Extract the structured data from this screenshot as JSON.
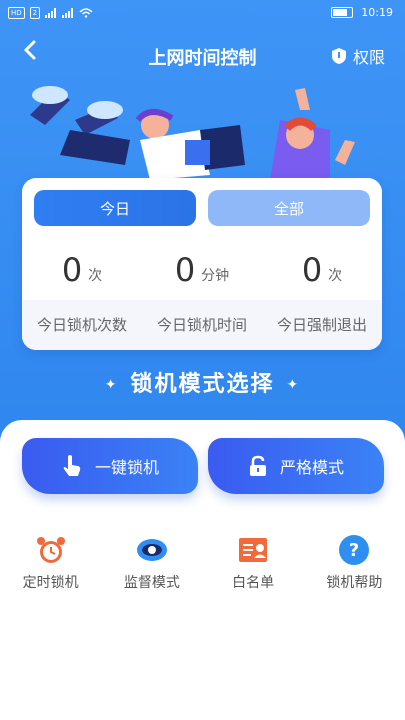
{
  "status": {
    "left_icons": [
      "hd-icon",
      "sim-icon",
      "signal-icon",
      "signal-4g-icon",
      "wifi-icon"
    ],
    "time": "10:19"
  },
  "nav": {
    "title": "上网时间控制",
    "permission_label": "权限"
  },
  "tabs": {
    "today": "今日",
    "all": "全部"
  },
  "stats": [
    {
      "value": "0",
      "unit": "次",
      "label": "今日锁机次数"
    },
    {
      "value": "0",
      "unit": "分钟",
      "label": "今日锁机时间"
    },
    {
      "value": "0",
      "unit": "次",
      "label": "今日强制退出"
    }
  ],
  "mode_section": {
    "title": "锁机模式选择"
  },
  "buttons": {
    "one_key": "一键锁机",
    "strict": "严格模式"
  },
  "tools": [
    {
      "label": "定时锁机",
      "icon": "alarm-clock-icon"
    },
    {
      "label": "监督模式",
      "icon": "eye-icon"
    },
    {
      "label": "白名单",
      "icon": "id-card-icon"
    },
    {
      "label": "锁机帮助",
      "icon": "help-icon"
    }
  ],
  "colors": {
    "primary": "#3f95f6",
    "accent": "#3a5bf0",
    "tool_orange": "#f26a3a",
    "tool_blue": "#2f8ff0"
  }
}
